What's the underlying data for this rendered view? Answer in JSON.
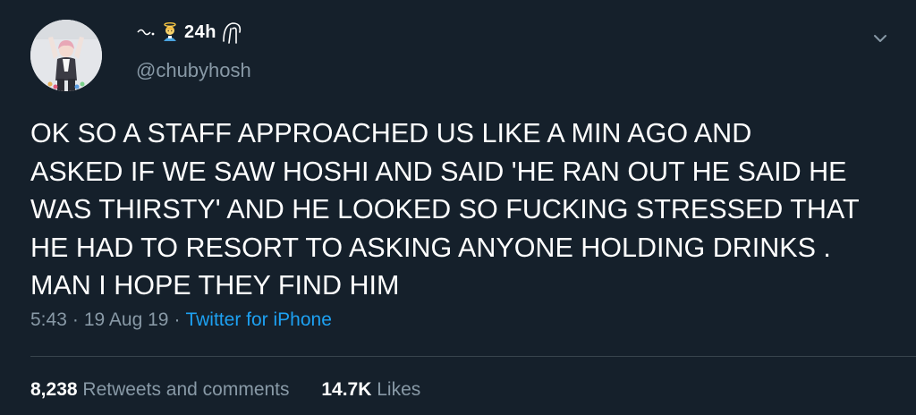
{
  "user": {
    "display_name": "24h",
    "handle": "@chubyhosh"
  },
  "tweet": {
    "text": "OK SO A STAFF APPROACHED US LIKE A MIN AGO AND\nASKED IF WE SAW HOSHI AND SAID 'HE RAN OUT HE SAID HE\nWAS THIRSTY' AND HE LOOKED SO FUCKING STRESSED THAT\nHE HAD TO RESORT TO ASKING ANYONE HOLDING DRINKS   .\nMAN I HOPE THEY FIND HIM",
    "time": "5:43",
    "date": "19 Aug 19",
    "source": "Twitter for iPhone"
  },
  "stats": {
    "retweets_count": "8,238",
    "retweets_label": "Retweets and comments",
    "likes_count": "14.7K",
    "likes_label": "Likes"
  },
  "icons": {
    "more": "chevron-down-icon",
    "name_emoji": "angel-emoji-icon"
  },
  "colors": {
    "background": "#15202b",
    "text": "#ffffff",
    "secondary": "#8899a6",
    "link": "#1da1f2",
    "divider": "#38444d"
  }
}
